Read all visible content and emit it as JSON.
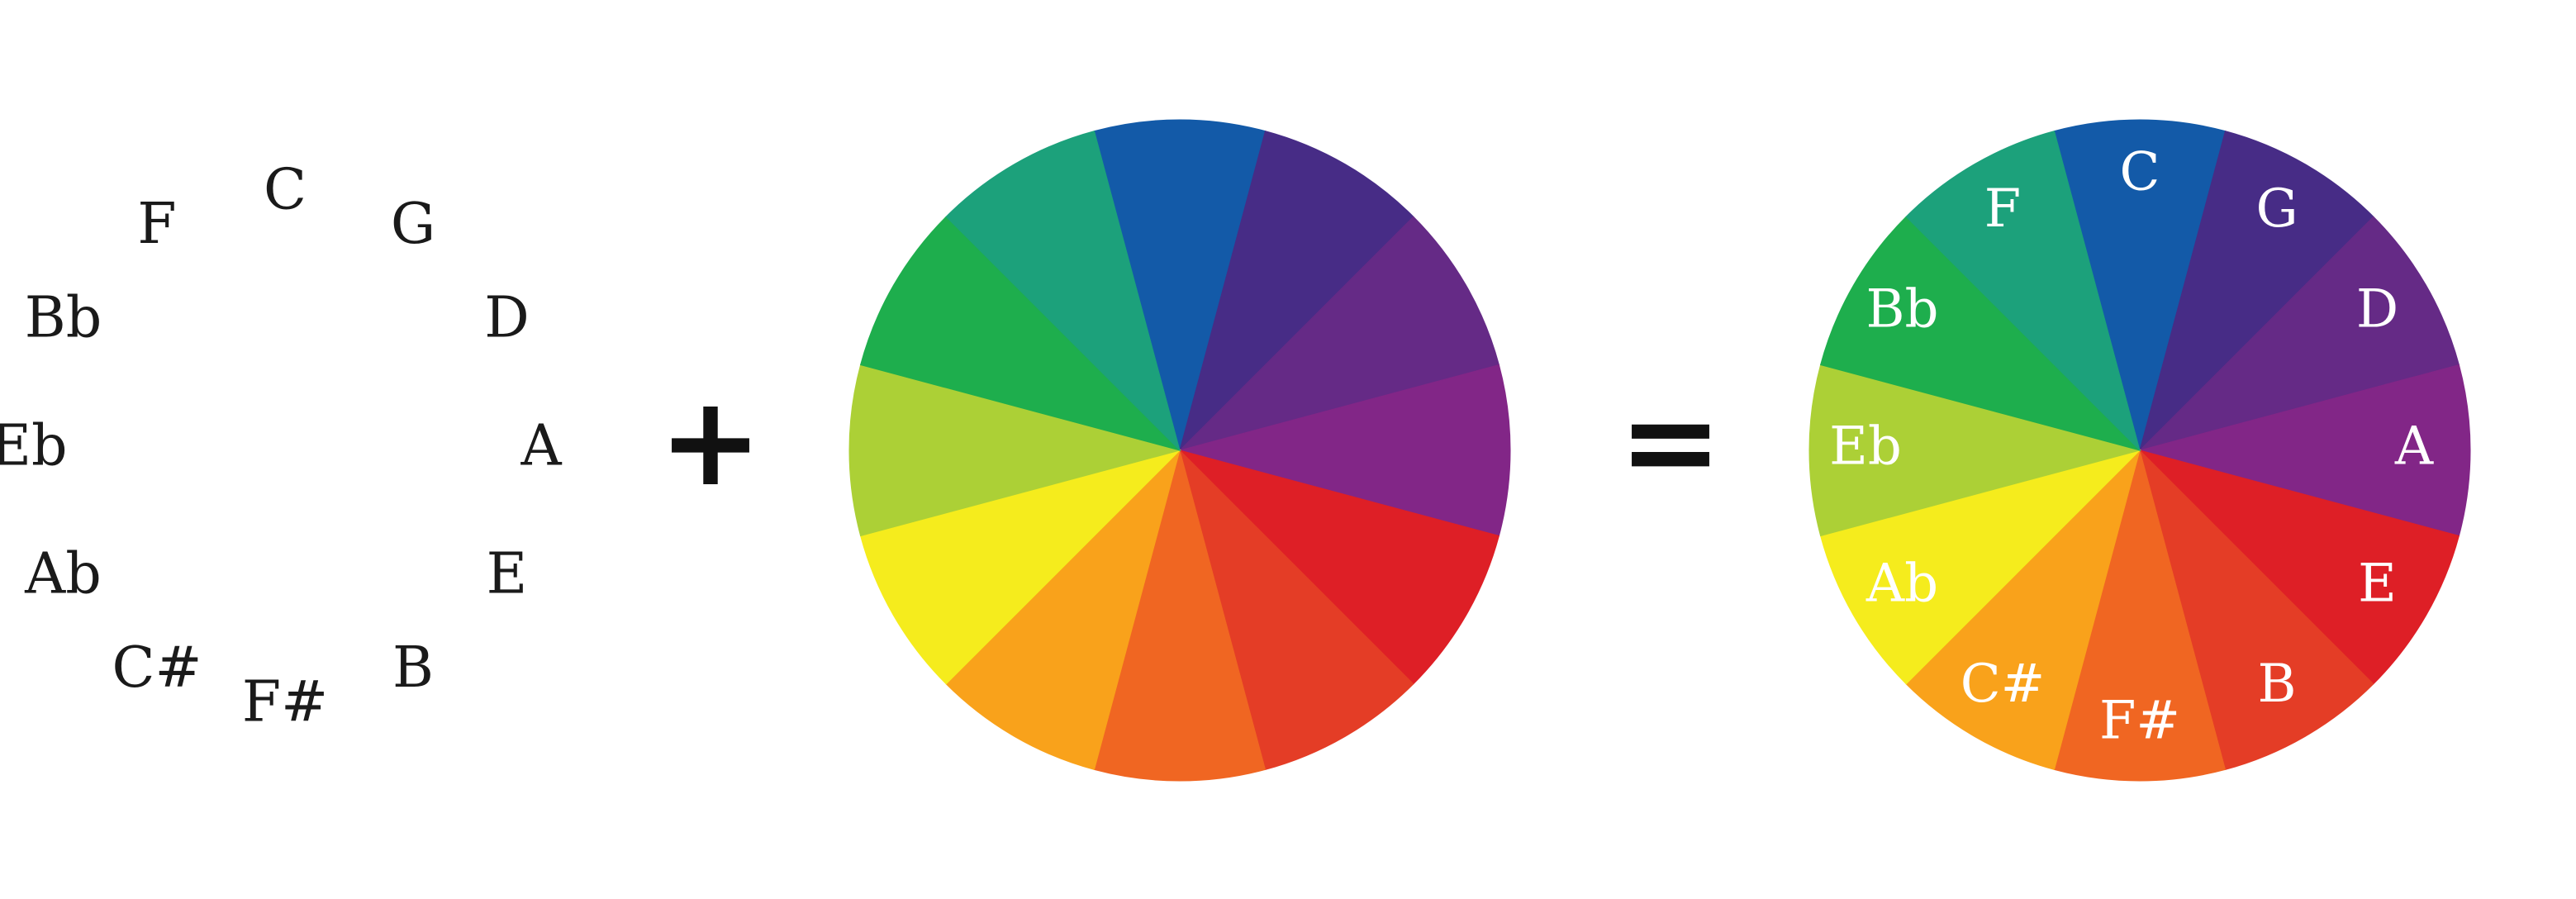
{
  "notes": [
    "C",
    "G",
    "D",
    "A",
    "E",
    "B",
    "F#",
    "C#",
    "Ab",
    "Eb",
    "Bb",
    "F"
  ],
  "colors": [
    "#135aa8",
    "#472c86",
    "#652a86",
    "#822687",
    "#de1f26",
    "#e43d26",
    "#f06622",
    "#f9a21b",
    "#f5ec1d",
    "#acd036",
    "#1eae4d",
    "#1ca17b"
  ],
  "operators": {
    "plus": "+",
    "equals": "="
  }
}
